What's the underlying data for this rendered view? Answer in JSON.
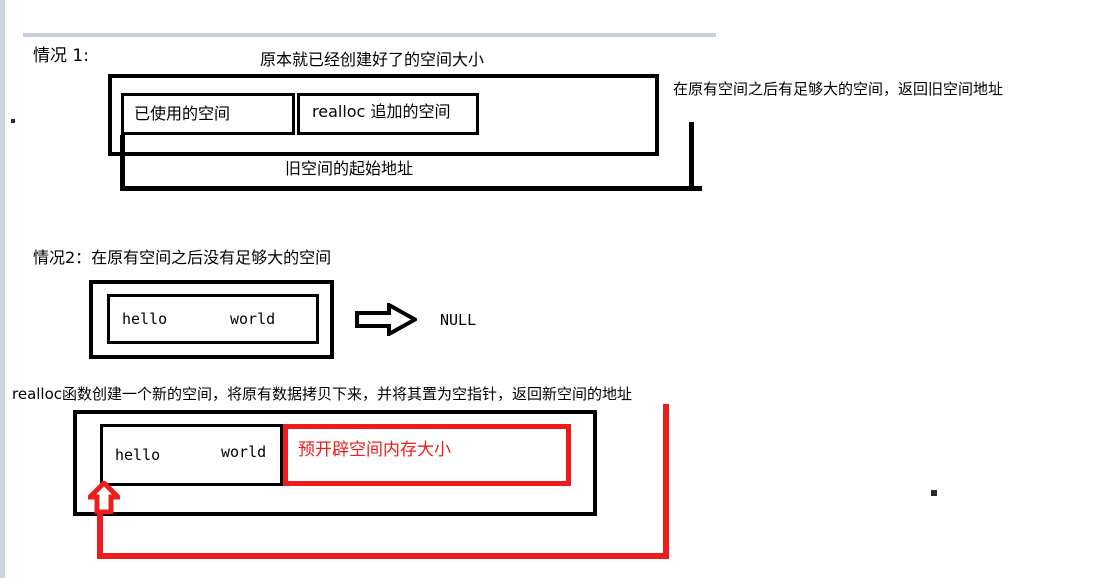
{
  "page": {
    "accent_rail_color": "#ccd4e2",
    "divider_color": "#c6cfdf",
    "ink_color": "#000000",
    "red_color": "#ee1c1c"
  },
  "section1": {
    "title": "情况 1:",
    "top_caption": "原本就已经创建好了的空间大小",
    "used_block_label": "已使用的空间",
    "added_block_label": "realloc 追加的空间",
    "pointer_caption": "旧空间的起始地址",
    "right_note": "在原有空间之后有足够大的空间，返回旧空间地址"
  },
  "section2": {
    "title": "情况2：在原有空间之后没有足够大的空间",
    "string_left": "hello",
    "string_right": "world",
    "result": "NULL",
    "arrow_icon": "arrow-right-hollow"
  },
  "section3": {
    "caption": "realloc函数创建一个新的空间，将原有数据拷贝下来，并将其置为空指针，返回新空间的地址",
    "string_left": "hello",
    "string_right": "world",
    "red_block_label": "预开辟空间内存大小",
    "arrow_icon": "arrow-up-hollow-red"
  }
}
